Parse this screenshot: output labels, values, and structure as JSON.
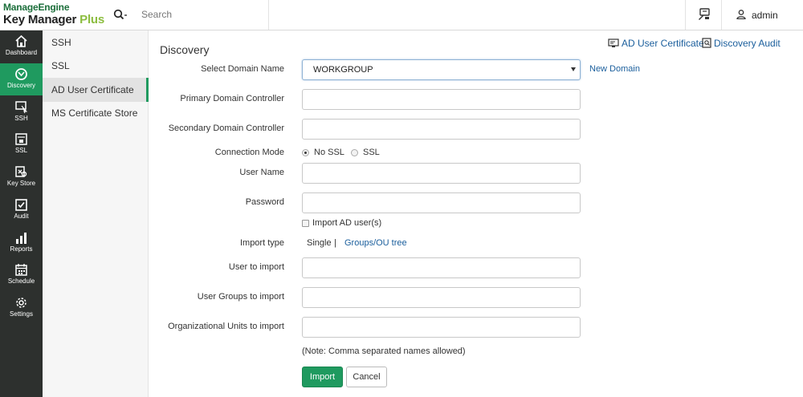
{
  "brand": {
    "line1a": "Manage",
    "line1b": "Engine",
    "line2a": "Key Manager ",
    "line2b": "Plus"
  },
  "search": {
    "placeholder": "Search"
  },
  "header": {
    "user_name": "admin"
  },
  "colors": {
    "accent": "#1f9a5f",
    "nav_bg": "#2d302e",
    "link": "#1a5e9c"
  },
  "leftnav": [
    {
      "label": "Dashboard",
      "icon": "home-icon"
    },
    {
      "label": "Discovery",
      "icon": "discovery-icon",
      "active": true
    },
    {
      "label": "SSH",
      "icon": "ssh-icon"
    },
    {
      "label": "SSL",
      "icon": "ssl-icon"
    },
    {
      "label": "Key Store",
      "icon": "key-store-icon"
    },
    {
      "label": "Audit",
      "icon": "audit-icon"
    },
    {
      "label": "Reports",
      "icon": "reports-icon"
    },
    {
      "label": "Schedule",
      "icon": "schedule-icon"
    },
    {
      "label": "Settings",
      "icon": "settings-icon"
    }
  ],
  "subnav": [
    {
      "label": "SSH"
    },
    {
      "label": "SSL"
    },
    {
      "label": "AD User Certificate",
      "active": true
    },
    {
      "label": "MS Certificate Store"
    }
  ],
  "page": {
    "title": "Discovery",
    "links": {
      "ad_user_cert": "AD User Certificate",
      "discovery_audit": "Discovery Audit"
    }
  },
  "form": {
    "select_domain_label": "Select Domain Name",
    "select_domain_value": "WORKGROUP",
    "new_domain": "New Domain",
    "primary_dc_label": "Primary Domain Controller",
    "primary_dc_value": "",
    "secondary_dc_label": "Secondary Domain Controller",
    "secondary_dc_value": "",
    "connection_mode_label": "Connection Mode",
    "conn_no_ssl": "No SSL",
    "conn_ssl": "SSL",
    "conn_selected": "No SSL",
    "user_name_label": "User Name",
    "user_name_value": "",
    "password_label": "Password",
    "password_value": "",
    "import_ad_users": "Import AD user(s)",
    "import_ad_users_checked": false,
    "import_type_label": "Import type",
    "import_single": "Single",
    "import_sep": "|",
    "import_groups": "Groups/OU tree",
    "user_to_import_label": "User to import",
    "user_groups_label": "User Groups to import",
    "org_units_label": "Organizational Units to import",
    "note": "(Note: Comma separated names allowed)",
    "import_button": "Import",
    "cancel_button": "Cancel"
  }
}
